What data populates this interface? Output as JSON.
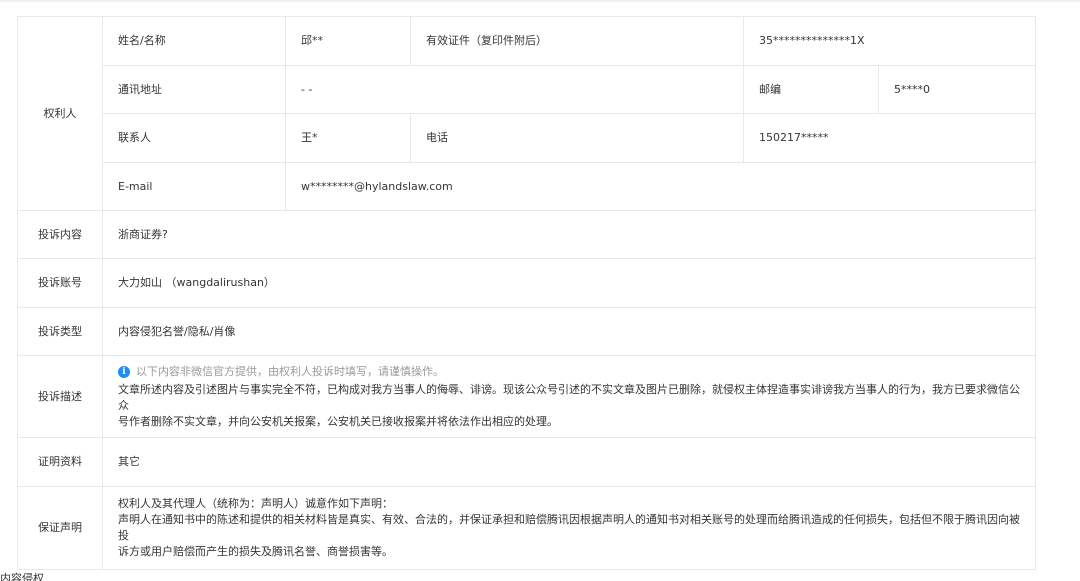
{
  "rights_holder": {
    "section_label": "权利人",
    "name_label": "姓名/名称",
    "name_value": "邱**",
    "id_label": "有效证件（复印件附后）",
    "id_value": "35**************1X",
    "address_label": "通讯地址",
    "address_value": "- -",
    "postcode_label": "邮编",
    "postcode_value": "5****0",
    "contact_label": "联系人",
    "contact_value": "王*",
    "phone_label": "电话",
    "phone_value": "150217*****",
    "email_label": "E-mail",
    "email_value": "w********@hylandslaw.com"
  },
  "complaint_content": {
    "label": "投诉内容",
    "value": "浙商证券?"
  },
  "complaint_account": {
    "label": "投诉账号",
    "value": "大力如山 （wangdalirushan）"
  },
  "complaint_type": {
    "label": "投诉类型",
    "value": "内容侵犯名誉/隐私/肖像"
  },
  "complaint_description": {
    "label": "投诉描述",
    "notice": "以下内容非微信官方提供，由权利人投诉时填写，请谨慎操作。",
    "info_icon": "i",
    "text_line1": "文章所述内容及引述图片与事实完全不符，已构成对我方当事人的侮辱、诽谤。现该公众号引述的不实文章及图片已删除，就侵权主体捏造事实诽谤我方当事人的行为，我方已要求微信公众",
    "text_line2": "号作者删除不实文章，并向公安机关报案，公安机关已接收报案并将依法作出相应的处理。"
  },
  "evidence": {
    "label": "证明资料",
    "value": "其它"
  },
  "guarantee": {
    "label": "保证声明",
    "line1": "权利人及其代理人（统称为：声明人）诚意作如下声明：",
    "line2": "声明人在通知书中的陈述和提供的相关材料皆是真实、有效、合法的，并保证承担和赔偿腾讯因根据声明人的通知书对相关账号的处理而给腾讯造成的任何损失，包括但不限于腾讯因向被投",
    "line3": "诉方或用户赔偿而产生的损失及腾讯名誉、商誉损害等。"
  },
  "bottom_fragment": "内容侵权"
}
